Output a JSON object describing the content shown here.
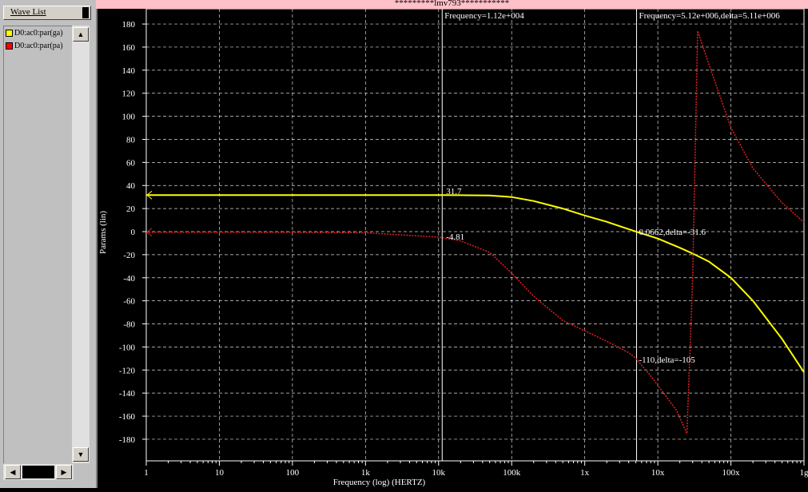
{
  "window_title": "*********lmv793***********",
  "wave_list": {
    "header": "Wave List",
    "items": [
      {
        "label": "D0:ac0:par(ga)",
        "color": "#ffff00"
      },
      {
        "label": "D0:ac0:par(pa)",
        "color": "#ff0000"
      }
    ]
  },
  "colors": {
    "gain": "#ffff00",
    "phase": "#e02020",
    "grid": "#ffffff",
    "axis_text": "#ffffff",
    "title_bar": "#ffc0c8"
  },
  "cursors": {
    "c1_readout": "Frequency=1.12e+004",
    "c2_readout": "Frequency=5.12e+006,delta=5.11e+006"
  },
  "marker_labels": {
    "gain_c1": "31.7",
    "phase_c1": "-4.81",
    "gain_c2": "0.0662,delta=-31.6",
    "phase_c2": "-110,delta=-105"
  },
  "chart_data": {
    "type": "line",
    "xscale": "log",
    "xlim": [
      1,
      1000000000
    ],
    "ylim": [
      -190,
      190
    ],
    "xticks": [
      1,
      10,
      100,
      1000,
      10000,
      100000,
      1000000,
      10000000,
      100000000,
      1000000000
    ],
    "xtick_labels": [
      "1",
      "10",
      "100",
      "1k",
      "10k",
      "100k",
      "1x",
      "10x",
      "100x",
      "1g"
    ],
    "yticks": [
      180,
      160,
      140,
      120,
      100,
      80,
      60,
      40,
      20,
      0,
      -20,
      -40,
      -60,
      -80,
      -100,
      -120,
      -140,
      -160,
      -180
    ],
    "xlabel": "Frequency (log) (HERTZ)",
    "ylabel": "Params (lin)",
    "grid": true,
    "series": [
      {
        "name": "D0:ac0:par(ga)",
        "x": [
          1,
          10,
          100,
          1000,
          10000,
          20000,
          50000,
          100000,
          200000,
          500000,
          1000000,
          2000000,
          5000000,
          10000000,
          20000000,
          30000000,
          50000000,
          100000000,
          200000000,
          500000000,
          1000000000
        ],
        "y": [
          31.7,
          31.7,
          31.7,
          31.7,
          31.7,
          31.6,
          31.3,
          30,
          26.5,
          20,
          14,
          8.5,
          0.0662,
          -6,
          -14,
          -19,
          -26,
          -40,
          -60,
          -93,
          -122
        ]
      },
      {
        "name": "D0:ac0:par(pa)",
        "x": [
          1,
          10,
          100,
          1000,
          10000,
          20000,
          50000,
          100000,
          200000,
          500000,
          1000000,
          2000000,
          4000000,
          5000000,
          8000000,
          12000000,
          18000000,
          25000000,
          30000000,
          35000000,
          50000000,
          100000000,
          200000000,
          500000000,
          1000000000
        ],
        "y": [
          -0.5,
          -0.5,
          -0.6,
          -1,
          -4.81,
          -8,
          -18,
          -36,
          -56,
          -77,
          -86,
          -95,
          -105,
          -110,
          -125,
          -140,
          -155,
          -175,
          -40,
          174,
          145,
          90,
          55,
          25,
          8
        ]
      }
    ],
    "cursors_x": [
      11200,
      5120000
    ]
  }
}
